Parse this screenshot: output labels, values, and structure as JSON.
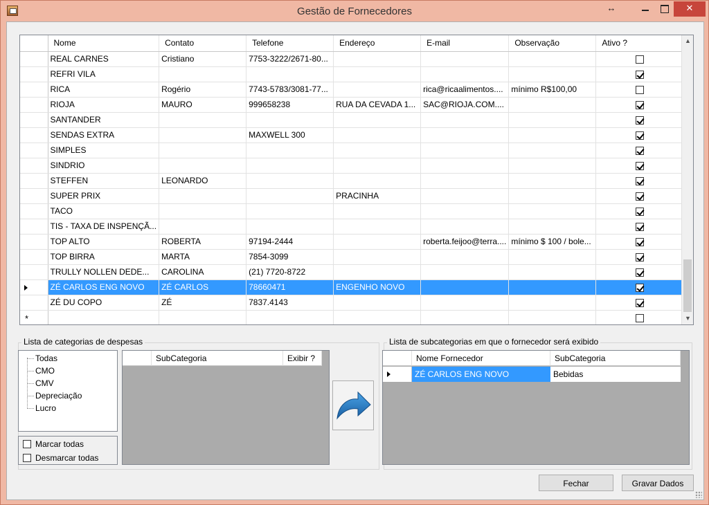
{
  "window": {
    "title": "Gestão de Fornecedores",
    "resize_glyph": "↔",
    "close_glyph": "✕"
  },
  "suppliers_grid": {
    "columns": [
      "Nome",
      "Contato",
      "Telefone",
      "Endereço",
      "E-mail",
      "Observação",
      "Ativo ?"
    ],
    "rows": [
      {
        "nome": "REAL CARNES",
        "contato": "Cristiano",
        "telefone": "7753-3222/2671-80...",
        "endereco": "",
        "email": "",
        "observacao": "",
        "ativo": false
      },
      {
        "nome": "REFRI VILA",
        "contato": "",
        "telefone": "",
        "endereco": "",
        "email": "",
        "observacao": "",
        "ativo": true
      },
      {
        "nome": "RICA",
        "contato": "Rogério",
        "telefone": "7743-5783/3081-77...",
        "endereco": "",
        "email": "rica@ricaalimentos....",
        "observacao": "mínimo R$100,00",
        "ativo": false
      },
      {
        "nome": "RIOJA",
        "contato": "MAURO",
        "telefone": "999658238",
        "endereco": "RUA DA CEVADA 1...",
        "email": "SAC@RIOJA.COM....",
        "observacao": "",
        "ativo": true
      },
      {
        "nome": "SANTANDER",
        "contato": "",
        "telefone": "",
        "endereco": "",
        "email": "",
        "observacao": "",
        "ativo": true
      },
      {
        "nome": "SENDAS EXTRA",
        "contato": "",
        "telefone": " MAXWELL 300",
        "endereco": "",
        "email": "",
        "observacao": "",
        "ativo": true
      },
      {
        "nome": "SIMPLES",
        "contato": "",
        "telefone": "",
        "endereco": "",
        "email": "",
        "observacao": "",
        "ativo": true
      },
      {
        "nome": "SINDRIO",
        "contato": "",
        "telefone": "",
        "endereco": "",
        "email": "",
        "observacao": "",
        "ativo": true
      },
      {
        "nome": "STEFFEN",
        "contato": "LEONARDO",
        "telefone": "",
        "endereco": "",
        "email": "",
        "observacao": "",
        "ativo": true
      },
      {
        "nome": "SUPER PRIX",
        "contato": "",
        "telefone": "",
        "endereco": "PRACINHA",
        "email": "",
        "observacao": "",
        "ativo": true
      },
      {
        "nome": "TACO",
        "contato": "",
        "telefone": "",
        "endereco": "",
        "email": "",
        "observacao": "",
        "ativo": true
      },
      {
        "nome": "TIS - TAXA DE INSPENÇÃ...",
        "contato": "",
        "telefone": "",
        "endereco": "",
        "email": "",
        "observacao": "",
        "ativo": true
      },
      {
        "nome": "TOP ALTO",
        "contato": "ROBERTA",
        "telefone": "97194-2444",
        "endereco": "",
        "email": "roberta.feijoo@terra....",
        "observacao": "mínimo $ 100 / bole...",
        "ativo": true
      },
      {
        "nome": "TOP BIRRA",
        "contato": "MARTA",
        "telefone": "7854-3099",
        "endereco": "",
        "email": "",
        "observacao": "",
        "ativo": true
      },
      {
        "nome": "TRULLY NOLLEN DEDE...",
        "contato": "CAROLINA",
        "telefone": "(21) 7720-8722",
        "endereco": "",
        "email": "",
        "observacao": "",
        "ativo": true
      },
      {
        "nome": "ZÉ CARLOS ENG NOVO",
        "contato": "ZÉ CARLOS",
        "telefone": "78660471",
        "endereco": "ENGENHO NOVO",
        "email": "",
        "observacao": "",
        "ativo": true,
        "selected": true
      },
      {
        "nome": "ZÉ DU COPO",
        "contato": "ZÉ",
        "telefone": "7837.4143",
        "endereco": "",
        "email": "",
        "observacao": "",
        "ativo": true
      }
    ],
    "new_row_marker": "*"
  },
  "categories": {
    "label": "Lista de categorias de despesas",
    "items": [
      "Todas",
      "CMO",
      "CMV",
      "Depreciação",
      "Lucro"
    ],
    "mark_all": "Marcar todas",
    "unmark_all": "Desmarcar todas",
    "sub_columns": [
      "SubCategoria",
      "Exibir ?"
    ]
  },
  "subcategories": {
    "label": "Lista de subcategorias em que o fornecedor será exibido",
    "columns": [
      "Nome Fornecedor",
      "SubCategoria"
    ],
    "row": {
      "fornecedor": "ZÉ CARLOS ENG NOVO",
      "subcategoria": "Bebidas"
    }
  },
  "buttons": {
    "close": "Fechar",
    "save": "Gravar Dados"
  },
  "colors": {
    "selection": "#3399ff",
    "title_bar": "#f0b8a4",
    "close_button": "#c7453b",
    "arrow": "#1a6fb8"
  }
}
